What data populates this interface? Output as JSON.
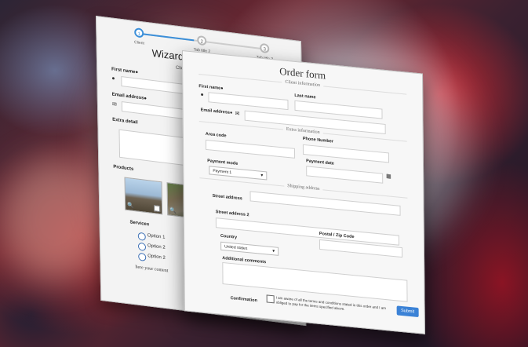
{
  "wizard": {
    "steps": [
      {
        "num": "1",
        "label": "Client"
      },
      {
        "num": "2",
        "label": "Tab title 2"
      },
      {
        "num": "3",
        "label": "Tab title 3"
      }
    ],
    "title": "Wizard form - step 1",
    "section": "Client information",
    "first_name_label": "First name●",
    "email_label": "Email address●",
    "extra_label": "Extra detail",
    "products_label": "Products",
    "services_label": "Services",
    "options": [
      "Option 1",
      "Option 2",
      "Option 2"
    ],
    "footer_text": "here your content"
  },
  "order": {
    "title": "Order form",
    "client_section": "Client information",
    "first_name_label": "First name●",
    "last_name_label": "Last name",
    "email_label": "Email address●",
    "extra_section": "Extra information",
    "area_code_label": "Area code",
    "phone_label": "Phone Number",
    "payment_mode_label": "Payment mode",
    "payment_mode_value": "Payment 1",
    "payment_date_label": "Payment date",
    "shipping_section": "Shipping address",
    "street1_label": "Street address",
    "street2_label": "Street address 2",
    "postal_label": "Postal / Zip Code",
    "country_label": "Country",
    "country_value": "United states",
    "comments_label": "Additional comments",
    "confirmation_label": "Confirmation",
    "terms_text": "I am aware of all the terms and conditions stated in this order and I am obliged to pay for the items specified above.",
    "submit_label": "Submit"
  },
  "colors": {
    "accent": "#3b82d6"
  }
}
